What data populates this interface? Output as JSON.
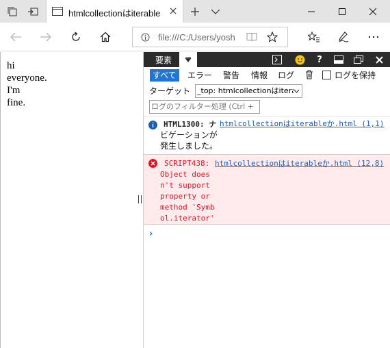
{
  "browser": {
    "tab": {
      "title": "htmlcollectionはiterable"
    },
    "address": {
      "url": "file:///C:/Users/yosh"
    }
  },
  "page": {
    "lines": [
      "hi",
      "everyone.",
      "I'm",
      "fine."
    ]
  },
  "devtools": {
    "tabs": {
      "elements": "要素"
    },
    "filters": {
      "all": "すべて",
      "errors": "エラー",
      "warnings": "警告",
      "info": "情報",
      "logs": "ログ",
      "preserve_log": "ログを保持"
    },
    "target": {
      "label": "ターゲット",
      "value": "_top: htmlcollectionはitera"
    },
    "filter_input": {
      "placeholder": "ログのフィルター処理 (Ctrl +"
    },
    "messages": [
      {
        "level": "info",
        "code": "HTML1300: ナ",
        "text_lines": [
          "ビゲーションが",
          "発生しました。"
        ],
        "source": "htmlcollectionはiterableか.html (1,1)"
      },
      {
        "level": "error",
        "code": "SCRIPT438:",
        "text_lines": [
          "Object does",
          "n't support",
          "property or",
          "method 'Symb",
          "ol.iterator'"
        ],
        "source": "htmlcollectionはiterableか.html (12,8)"
      }
    ],
    "prompt": "›"
  },
  "colors": {
    "accent": "#1e76d6",
    "error": "#e81123",
    "error_bg": "#ffebeb",
    "link": "#1a5dbf",
    "devtools_bar": "#2b2b2b"
  }
}
